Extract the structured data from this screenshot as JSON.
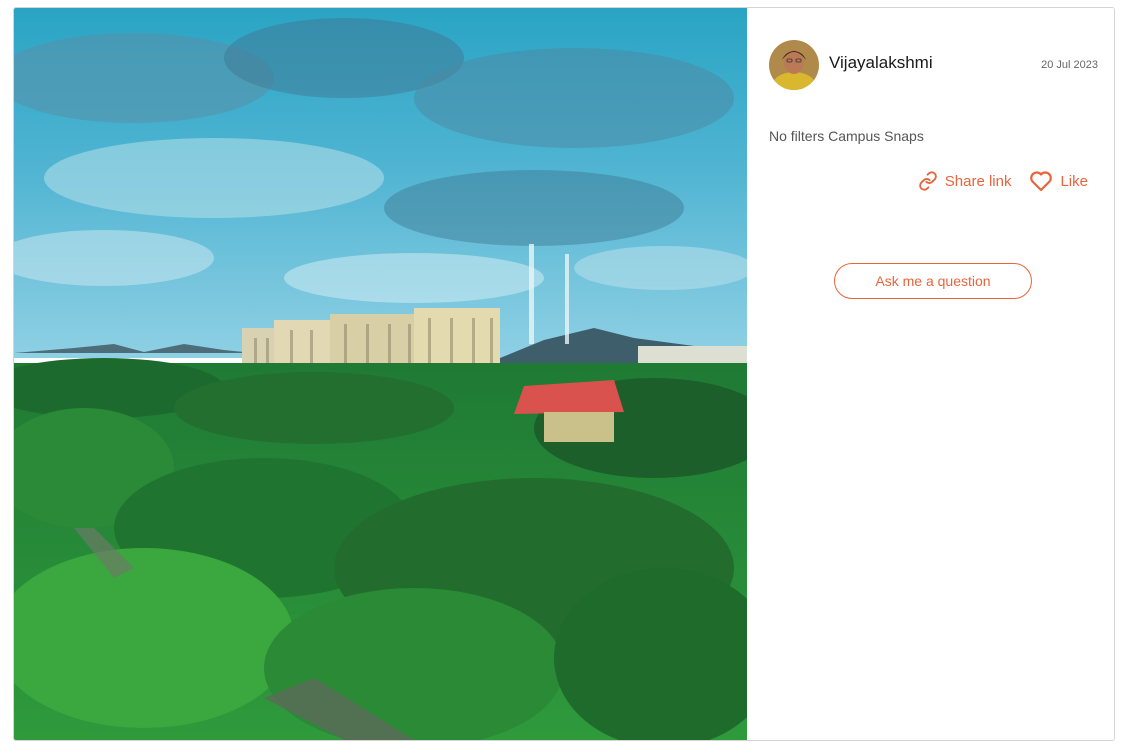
{
  "post": {
    "author": "Vijayalakshmi",
    "date": "20 Jul 2023",
    "caption": "No filters Campus Snaps"
  },
  "actions": {
    "share_label": "Share link",
    "like_label": "Like",
    "ask_label": "Ask me a question"
  },
  "icons": {
    "share": "link-icon",
    "like": "heart-icon"
  },
  "colors": {
    "accent": "#e8643c"
  }
}
